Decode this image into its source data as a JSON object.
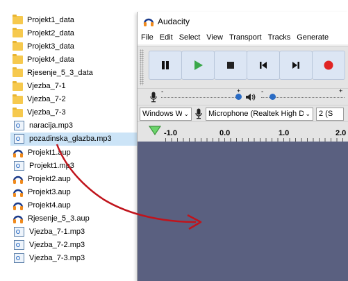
{
  "explorer": {
    "files": [
      {
        "name": "Projekt1_data",
        "type": "folder"
      },
      {
        "name": "Projekt2_data",
        "type": "folder"
      },
      {
        "name": "Projekt3_data",
        "type": "folder"
      },
      {
        "name": "Projekt4_data",
        "type": "folder"
      },
      {
        "name": "Rjesenje_5_3_data",
        "type": "folder"
      },
      {
        "name": "Vjezba_7-1",
        "type": "folder"
      },
      {
        "name": "Vjezba_7-2",
        "type": "folder"
      },
      {
        "name": "Vjezba_7-3",
        "type": "folder"
      },
      {
        "name": "naracija.mp3",
        "type": "mp3"
      },
      {
        "name": "pozadinska_glazba.mp3",
        "type": "mp3",
        "selected": true
      },
      {
        "name": "Projekt1.aup",
        "type": "aup"
      },
      {
        "name": "Projekt1.mp3",
        "type": "mp3"
      },
      {
        "name": "Projekt2.aup",
        "type": "aup"
      },
      {
        "name": "Projekt3.aup",
        "type": "aup"
      },
      {
        "name": "Projekt4.aup",
        "type": "aup"
      },
      {
        "name": "Rjesenje_5_3.aup",
        "type": "aup"
      },
      {
        "name": "Vjezba_7-1.mp3",
        "type": "mp3"
      },
      {
        "name": "Vjezba_7-2.mp3",
        "type": "mp3"
      },
      {
        "name": "Vjezba_7-3.mp3",
        "type": "mp3"
      }
    ]
  },
  "audacity": {
    "title": "Audacity",
    "menu": [
      "File",
      "Edit",
      "Select",
      "View",
      "Transport",
      "Tracks",
      "Generate"
    ],
    "host_combo": "Windows W",
    "mic_combo": "Microphone (Realtek High D",
    "channels_combo": "2 (S",
    "timeline_ticks": [
      "1.0",
      "0.0",
      "1.0",
      "2.0"
    ],
    "timeline_neg_prefix": "-",
    "meter_ticks": [
      "-",
      "+",
      "-",
      "+"
    ]
  },
  "colors": {
    "track_bg": "#5a6080",
    "play_green": "#3aa84a",
    "record_red": "#e02424",
    "arrow_red": "#c0141c",
    "folder_yellow": "#f6c94e",
    "selection": "#cce4f7"
  }
}
